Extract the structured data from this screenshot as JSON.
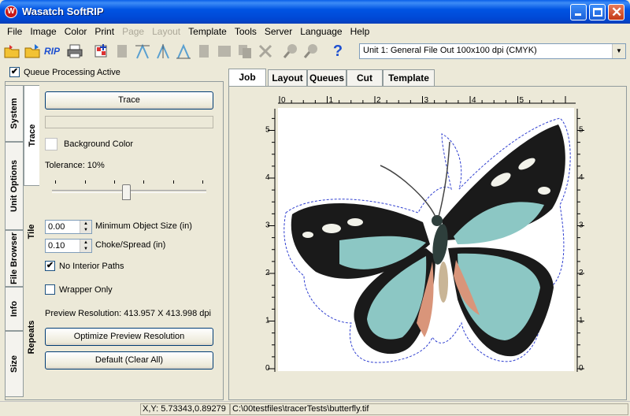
{
  "window": {
    "title": "Wasatch SoftRIP",
    "icon": "wasatch-logo-icon"
  },
  "menu": [
    {
      "label": "File",
      "enabled": true
    },
    {
      "label": "Image",
      "enabled": true
    },
    {
      "label": "Color",
      "enabled": true
    },
    {
      "label": "Print",
      "enabled": true
    },
    {
      "label": "Page",
      "enabled": false
    },
    {
      "label": "Layout",
      "enabled": false
    },
    {
      "label": "Template",
      "enabled": true
    },
    {
      "label": "Tools",
      "enabled": true
    },
    {
      "label": "Server",
      "enabled": true
    },
    {
      "label": "Language",
      "enabled": true
    },
    {
      "label": "Help",
      "enabled": true
    }
  ],
  "toolbar": {
    "rip_label": "RIP",
    "help_label": "?",
    "unit_selected": "Unit 1: General  File Out 100x100 dpi (CMYK)"
  },
  "queue_processing": {
    "label": "Queue Processing Active",
    "checked": true
  },
  "side_tabs": [
    "System",
    "Unit Options",
    "File Browser",
    "Info",
    "Size"
  ],
  "sub_tabs": [
    "Trace",
    "Tile",
    "Repeats"
  ],
  "trace": {
    "trace_button": "Trace",
    "background_color_label": "Background Color",
    "tolerance_label": "Tolerance: 10%",
    "tolerance_value": 10,
    "min_object_value": "0.00",
    "min_object_label": "Minimum Object Size (in)",
    "choke_value": "0.10",
    "choke_label": "Choke/Spread (in)",
    "no_interior_label": "No Interior Paths",
    "no_interior_checked": true,
    "wrapper_only_label": "Wrapper Only",
    "wrapper_only_checked": false,
    "preview_resolution": "Preview Resolution: 413.957 X 413.998 dpi",
    "optimize_button": "Optimize Preview Resolution",
    "default_button": "Default (Clear All)"
  },
  "tabs": [
    {
      "label": "Job",
      "active": true
    },
    {
      "label": "Layout",
      "active": false
    },
    {
      "label": "Queues",
      "active": false
    },
    {
      "label": "Cut",
      "active": false
    },
    {
      "label": "Template",
      "active": false
    }
  ],
  "ruler": {
    "h_labels": [
      "0",
      "1",
      "2",
      "3",
      "4",
      "5"
    ],
    "v_labels": [
      "5",
      "4",
      "3",
      "2",
      "1",
      "0"
    ]
  },
  "status": {
    "coords": "X,Y: 5.73343,0.89279",
    "file_path": "C:\\00testfiles\\tracerTests\\butterfly.tif"
  },
  "colors": {
    "title_bar": "#0054e3",
    "accent": "#0054e3",
    "cut_line": "#2f3fd0",
    "wing_teal": "#8cc7c4",
    "wing_dark": "#1a1a1a"
  }
}
